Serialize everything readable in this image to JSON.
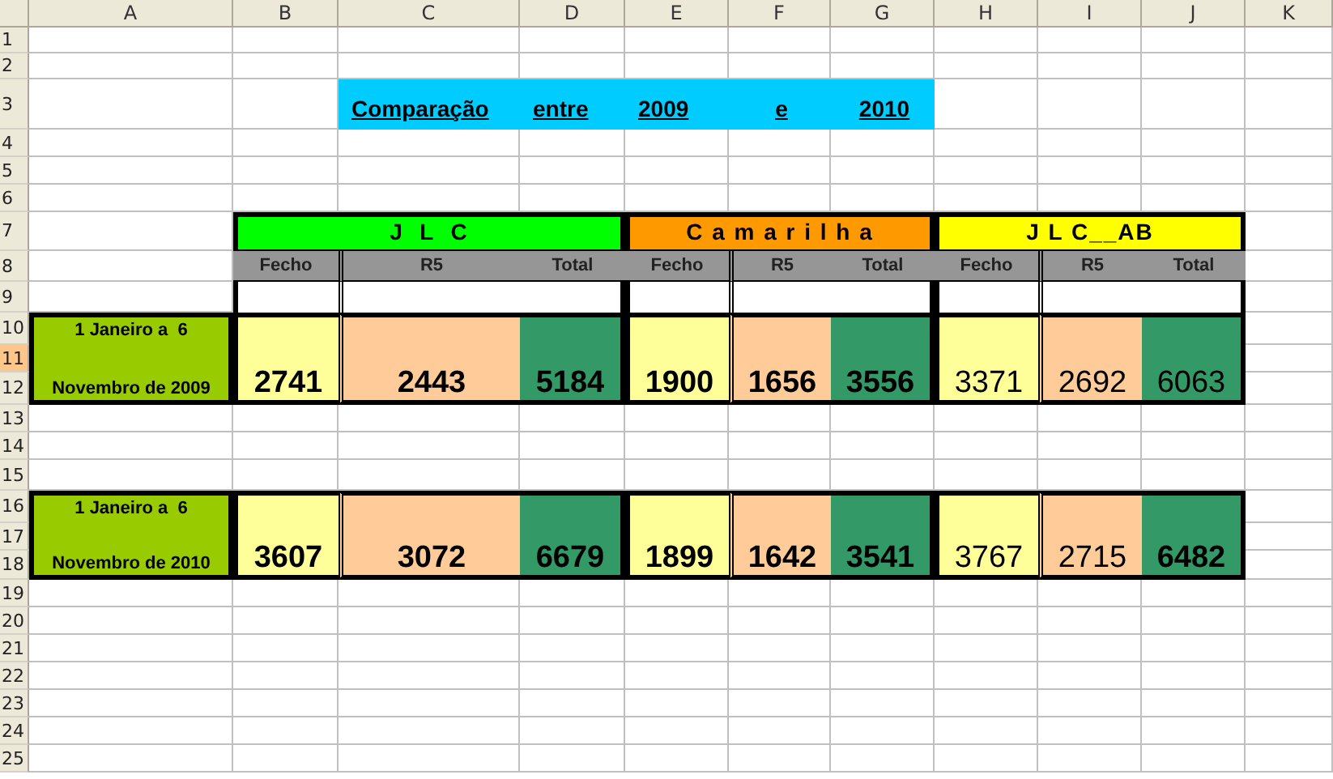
{
  "column_headers": [
    "A",
    "B",
    "C",
    "D",
    "E",
    "F",
    "G",
    "H",
    "I",
    "J",
    "K"
  ],
  "row_headers": [
    {
      "label": "1",
      "selected": false
    },
    {
      "label": "2",
      "selected": false
    },
    {
      "label": "3",
      "selected": false
    },
    {
      "label": "4",
      "selected": false
    },
    {
      "label": "5",
      "selected": false
    },
    {
      "label": "6",
      "selected": false
    },
    {
      "label": "7",
      "selected": false
    },
    {
      "label": "8",
      "selected": false
    },
    {
      "label": "9",
      "selected": false
    },
    {
      "label": "10",
      "selected": false
    },
    {
      "label": "11",
      "selected": true
    },
    {
      "label": "12",
      "selected": false
    },
    {
      "label": "13",
      "selected": false
    },
    {
      "label": "14",
      "selected": false
    },
    {
      "label": "15",
      "selected": false
    },
    {
      "label": "16",
      "selected": false
    },
    {
      "label": "17",
      "selected": false
    },
    {
      "label": "18",
      "selected": false
    },
    {
      "label": "19",
      "selected": false
    },
    {
      "label": "20",
      "selected": false
    },
    {
      "label": "21",
      "selected": false
    },
    {
      "label": "22",
      "selected": false
    },
    {
      "label": "23",
      "selected": false
    },
    {
      "label": "24",
      "selected": false
    },
    {
      "label": "25",
      "selected": false
    }
  ],
  "title_cells": [
    "Comparação",
    "entre",
    "2009",
    "e",
    "2010"
  ],
  "groups": [
    {
      "name": "J  L  C",
      "color": "#00ff00",
      "columns": [
        "Fecho",
        "R5",
        "Total"
      ]
    },
    {
      "name": "C a m a r i l h a",
      "color": "#ff9900",
      "columns": [
        "Fecho",
        "R5",
        "Total"
      ]
    },
    {
      "name": "J L C__AB",
      "color": "#ffff00",
      "columns": [
        "Fecho",
        "R5",
        "Total"
      ]
    }
  ],
  "periods": [
    {
      "line_1": "1 Janeiro a  6",
      "line_2": "Novembro de 2009",
      "values": [
        {
          "value": "2741",
          "bold": true
        },
        {
          "value": "2443",
          "bold": true
        },
        {
          "value": "5184",
          "bold": true
        },
        {
          "value": "1900",
          "bold": true
        },
        {
          "value": "1656",
          "bold": true
        },
        {
          "value": "3556",
          "bold": true
        },
        {
          "value": "3371",
          "bold": false
        },
        {
          "value": "2692",
          "bold": false
        },
        {
          "value": "6063",
          "bold": false
        }
      ]
    },
    {
      "line_1": "1 Janeiro a  6",
      "line_2": "Novembro de 2010",
      "values": [
        {
          "value": "3607",
          "bold": true
        },
        {
          "value": "3072",
          "bold": true
        },
        {
          "value": "6679",
          "bold": true
        },
        {
          "value": "1899",
          "bold": true
        },
        {
          "value": "1642",
          "bold": true
        },
        {
          "value": "3541",
          "bold": true
        },
        {
          "value": "3767",
          "bold": false
        },
        {
          "value": "2715",
          "bold": false
        },
        {
          "value": "6482",
          "bold": true
        }
      ]
    }
  ]
}
